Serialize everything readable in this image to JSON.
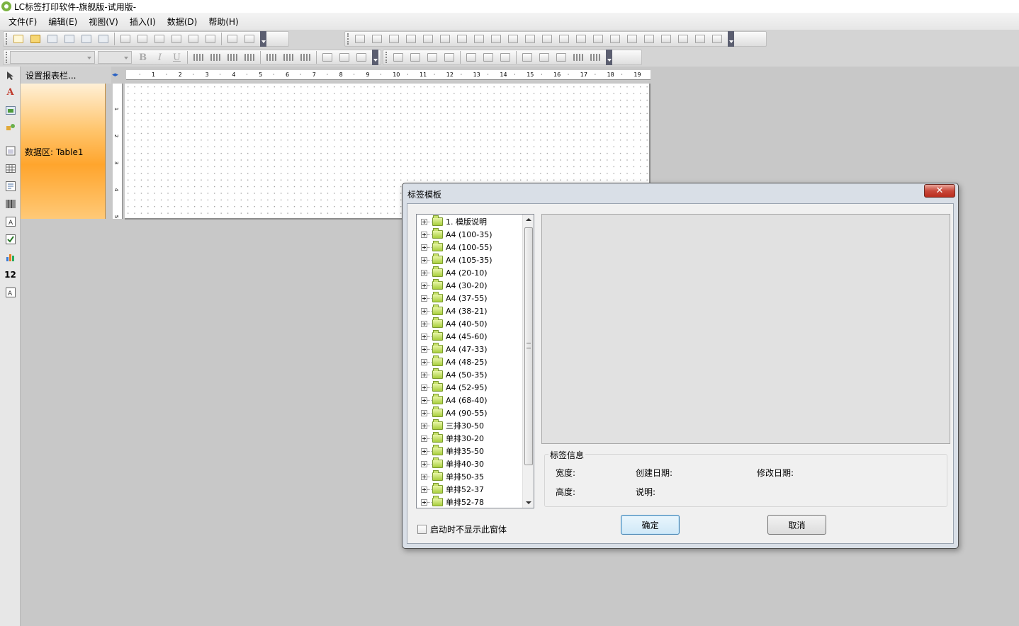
{
  "window": {
    "title": "LC标签打印软件-旗舰版-试用版-"
  },
  "menubar": {
    "items": [
      "文件(F)",
      "编辑(E)",
      "视图(V)",
      "插入(I)",
      "数据(D)",
      "帮助(H)"
    ]
  },
  "toolbar2": {
    "bold": "B",
    "italic": "I",
    "underline": "U"
  },
  "left_tools": {
    "text_tool": "A",
    "number_tool": "12"
  },
  "band_panel": {
    "header": "设置报表栏...",
    "data_band_label": "数据区: Table1"
  },
  "rulers": {
    "horizontal_ticks": [
      "1",
      "2",
      "3",
      "4",
      "5",
      "6",
      "7",
      "8",
      "9",
      "10",
      "11",
      "12",
      "13",
      "14",
      "15",
      "16",
      "17",
      "18",
      "19"
    ],
    "vertical_ticks": [
      "1",
      "2",
      "3",
      "4",
      "5"
    ]
  },
  "dialog": {
    "title": "标签模板",
    "close_glyph": "✕",
    "tree_items": [
      "1. 模版说明",
      "A4 (100-35)",
      "A4 (100-55)",
      "A4 (105-35)",
      "A4 (20-10)",
      "A4 (30-20)",
      "A4 (37-55)",
      "A4 (38-21)",
      "A4 (40-50)",
      "A4 (45-60)",
      "A4 (47-33)",
      "A4 (48-25)",
      "A4 (50-35)",
      "A4 (52-95)",
      "A4 (68-40)",
      "A4 (90-55)",
      "三排30-50",
      "单排30-20",
      "单排35-50",
      "单排40-30",
      "单排50-35",
      "单排52-37",
      "单排52-78"
    ],
    "info": {
      "legend": "标签信息",
      "width_label": "宽度:",
      "height_label": "高度:",
      "created_label": "创建日期:",
      "desc_label": "说明:",
      "modified_label": "修改日期:"
    },
    "dont_show_label": "启动时不显示此窗体",
    "ok_label": "确定",
    "cancel_label": "取消"
  }
}
